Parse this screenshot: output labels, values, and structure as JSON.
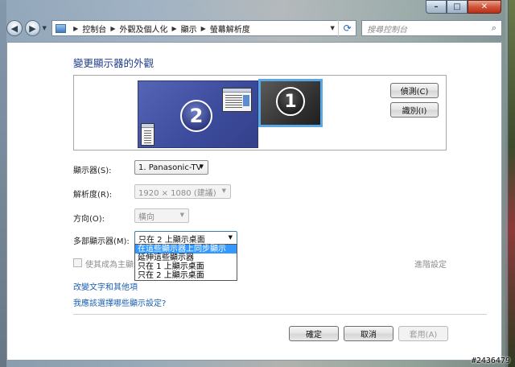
{
  "window": {
    "minimize": "–",
    "maximize": "□",
    "close": "✕"
  },
  "nav": {
    "back_icon": "back-arrow-icon",
    "forward_icon": "forward-arrow-icon",
    "breadcrumb": [
      "控制台",
      "外觀及個人化",
      "顯示",
      "螢幕解析度"
    ],
    "search_placeholder": "搜尋控制台"
  },
  "page": {
    "title": "變更顯示器的外觀"
  },
  "preview": {
    "monitor_secondary_number": "2",
    "monitor_primary_number": "1",
    "detect_label": "偵測(C)",
    "identify_label": "識別(I)"
  },
  "settings": {
    "display_label": "顯示器(S):",
    "display_value": "1. Panasonic-TV",
    "resolution_label": "解析度(R):",
    "resolution_value": "1920 × 1080 (建議)",
    "orientation_label": "方向(O):",
    "orientation_value": "橫向",
    "multi_label": "多部顯示器(M):",
    "multi_value": "只在 2 上顯示桌面",
    "multi_options": [
      "在這些顯示器上同步顯示",
      "延伸這些顯示器",
      "只在 1 上顯示桌面",
      "只在 2 上顯示桌面"
    ],
    "multi_selected_index": 0,
    "main_display_label": "使其成為主顯示",
    "advanced_link": "進階設定"
  },
  "links": {
    "text_size": "改變文字和其他項",
    "which_settings": "我應該選擇哪些顯示設定?"
  },
  "footer": {
    "ok": "確定",
    "cancel": "取消",
    "apply": "套用(A)"
  },
  "watermark": "#2436479",
  "colors": {
    "title_blue": "#1e3d8a",
    "link_blue": "#1c5fad",
    "selection_blue": "#3399ff",
    "primary_monitor_border": "#5aa7e6",
    "secondary_monitor": "#3c4a9c"
  }
}
